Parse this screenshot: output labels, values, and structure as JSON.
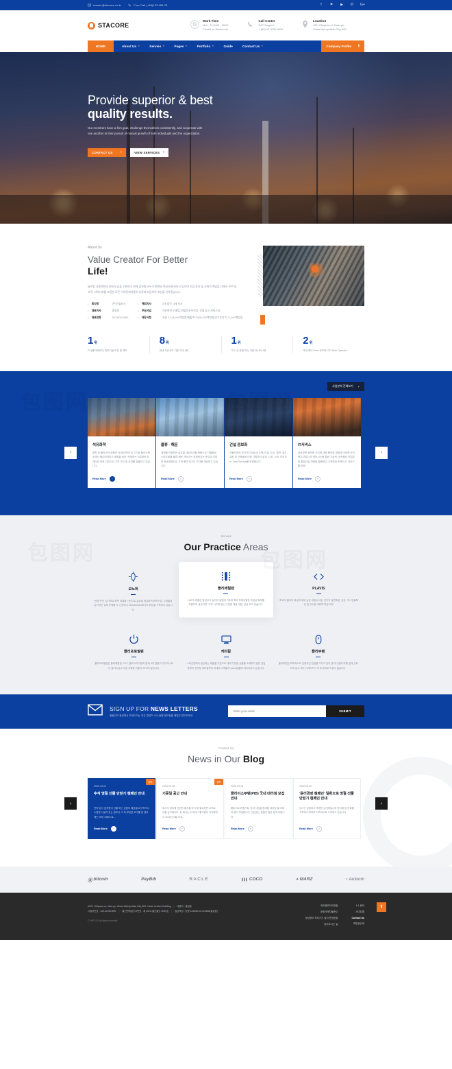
{
  "topbar": {
    "email": "master@stacore.co.kr",
    "phone": "Free Call (+86)123.456.78",
    "email_icon": "envelope-icon",
    "phone_icon": "phone-icon",
    "socials": [
      "f",
      "⚑",
      "▶",
      "ⓟ",
      "G+"
    ]
  },
  "header": {
    "logo_text": "STACORE",
    "info": [
      {
        "icon": "clock-icon",
        "title": "Work Time",
        "line1": "Mon - Fri 9:00 - 18:00",
        "line2": "Closed on Weekends"
      },
      {
        "icon": "phone-icon",
        "title": "Call Center",
        "line1": "24/7 Support",
        "line2": "+ (82) 00-0000-0000"
      },
      {
        "icon": "location-pin-icon",
        "title": "Location",
        "line1": "129, Okhyeon-ro, Nam-gu,",
        "line2": "Ulsan Metropolitan City, 802"
      }
    ]
  },
  "nav": {
    "home": "HOME",
    "items": [
      {
        "label": "About Us",
        "caret": "▼"
      },
      {
        "label": "Servies",
        "caret": "▼"
      },
      {
        "label": "Pages",
        "caret": "▼"
      },
      {
        "label": "Portfolio",
        "caret": "▼"
      },
      {
        "label": "Guide",
        "caret": ""
      },
      {
        "label": "Contact Us",
        "caret": "▼"
      }
    ],
    "cta": "Company Profile",
    "cta_icon": "download-icon"
  },
  "hero": {
    "line1": "Provide superior  & best",
    "line2": "quality  results.",
    "paragraph": "Our members have a firm goal, challenge themselves consistently, and cooperate with one another in their pursuit of mutual growth of both individuals and the organization.",
    "btn_primary": "CONTACT US",
    "btn_secondary": "VIEW SERVICES",
    "arrow": "›"
  },
  "about": {
    "eyebrow": "About Us",
    "title_light": "Value Creator For Better",
    "title_bold": "Life!",
    "paragraph": "글로벌 다품목화의 미래 모습을 구현하기 위해 임직원 모두가 변화와 혁신에 헌신하고 있으며 기업 윤리 및 사회적 책임을 다해서 주주 및 고객, 지역사회를 포함한 모든 이해관계자들의 성장에 보답하려 최선을 다하겠습니다.",
    "facts_col1": [
      {
        "key": "회사명",
        "value": "(주)산돌라스"
      },
      {
        "key": "대표이사",
        "value": "홍길동"
      },
      {
        "key": "대표전화",
        "value": "00-0000-0000"
      }
    ],
    "facts_col2": [
      {
        "key": "해외지사",
        "value": "2개 법인, 4개 지사"
      },
      {
        "key": "주요사업",
        "value": "석유화학 도매업, 화물운송주선업, 건설 및 IT서비스업"
      },
      {
        "key": "재무사항",
        "value": "자산 2,416,434백만원/매출액 2,628,219백만원/당기순이익 71,460백만원"
      }
    ],
    "image_alt": "worker-on-structure-photo"
  },
  "stats": [
    {
      "num": "1",
      "unit": "위",
      "desc": "PC(폴리머비드) 특허기술 보유 및 제조"
    },
    {
      "num": "8",
      "unit": "위",
      "desc": "연내 자산규모 기준 국내 8위"
    },
    {
      "num": "1",
      "unit": "위",
      "desc": "가스 선 운항 척수 기준 아시아 1위"
    },
    {
      "num": "2",
      "unit": "위",
      "desc": "국내 최대 Fleet 규모의 ISO Tank Operator"
    }
  ],
  "carousel": {
    "button": "사업분야 전체보기",
    "button_icon": "plus-icon",
    "prev_icon": "chevron-left-icon",
    "next_icon": "chevron-right-icon",
    "read_more": "Read More",
    "cards": [
      {
        "title": "석유화학",
        "body": "화학 및 플라스틱 제품의 국내외 판매 및 고기능 플라스틱 소재인 폴리아마이드 제품을 생산, 판매하는 석유화학 트레이딩 전문 기업으로 고객 가치 및 성과를 창출하고 있습니다."
      },
      {
        "title": "물류 · 해운",
        "body": "세계를 연결하는 글로벌 네트워크를 바탕으로 차별화된 스피드화물 물류·해운 서비스는 경쟁력있는 운임과 다양한 운송경쟁으로 고객 배려 최고의 가치를 제공하고 있습니다."
      },
      {
        "title": "건설 정보화",
        "body": "건물자재의 부가가치 상승과 주택, 타일, 도로, 항만, 철도, 교량 및 건축물에 대한 기획부터 설계, 시공, 시/도 이어지는 Total Service를 제공합니다."
      },
      {
        "title": "IT서비스",
        "body": "공공부문 정보화 사업에 대한 풍부한 경험과 다양한 아키텍처 파트너의 정보시스템 통합 기술력, 표준화된 방법론 및 통합사업 역량을 활용하여 고객에게 최적의 IT 서비스를 제공"
      }
    ]
  },
  "practice": {
    "eyebrow": "Servies",
    "title_bold": "Our Practice",
    "title_light": "Areas",
    "row1": [
      {
        "icon": "monomer-icon",
        "title": "모노머",
        "desc": "현재 산액, 싱가포르 화학 계열을 기반으로 글로벌 정유화학 화학기업, 고객들과 유기적인 업체 문제를 도·신장에서 Globaltrader로서의 위상을 구축하고 있습니다."
      },
      {
        "icon": "polyethylene-icon",
        "title": "폴리에틸렌",
        "desc": "HDPE 제품은 탈입크기 슬러리 공법에 기초한 특허 자체개발한 독점성 촉매를 적용하여 생산되며, 고객 니즈에 맞는 다양한 제품 개발, 공급 되고 있습니다.",
        "active": true
      },
      {
        "icon": "code-brackets-icon",
        "title": "PLAVIS",
        "desc": "최고의 물리적 특성과 매우 높은 내열시스템, 전기적 절연특성, 낮은 가스 방출특성 및 우수한 내화학 특성 보유"
      }
    ],
    "row2": [
      {
        "icon": "power-icon",
        "title": "폴리프로필렌",
        "desc": "폴리프로필렌은 폴리에틸렌, PVC, 폴리스타이렌과 함께 4대 범용수지이 하나로서, 열가소성수지 중 사용량 비중이 24%에 달한니다."
      },
      {
        "icon": "monitor-icon",
        "title": "케미칼",
        "desc": "스타산업에서 생산되는 제품을 기반으로 내외 다양한 상품을 소재까지 일반 공업용부터 전자용 케미칼까지 국내외 고객들의 value창출에 이바지하고 있습니다."
      },
      {
        "icon": "mouse-icon",
        "title": "폴리부텐",
        "desc": "폴리부텐은 화학적으로 안정적인 성질을 가지고 있어 빛이나 열에 의해 쉽게 산화되지 않고 모든 그레이드가 무색/무취로 독성이 없습니다."
      }
    ]
  },
  "newsletter": {
    "icon": "envelope-icon",
    "title_light": "SIGN UP FOR ",
    "title_bold": "NEWS LETTERS",
    "subtitle": "홍봉간이 정성에서 보내드리는 최신 콘텐츠 소식,동향,정보등을 메일로 받아보세요.",
    "placeholder": "Enter your email",
    "submit": "SUBMIT"
  },
  "blog": {
    "eyebrow": "Contact Us",
    "title_light": "News in Our ",
    "title_bold": "Blog",
    "read_more": "Read More",
    "prev_icon": "chevron-left-icon",
    "next_icon": "chevron-right-icon",
    "posts": [
      {
        "date": "2020.10.02",
        "badge": "공지",
        "title": "추석 명절 선물 안받기 캠페인 안내",
        "body": "만약 당사 임직원이 선물 또는 금품의 제공을 요구하거나 수령한 사실이 있는 경우나 그 외 부당한 요구를 한 경우에는 아래 <제보>로...",
        "highlight": true
      },
      {
        "date": "2020.09.28",
        "badge": "공지",
        "title": "기준일 공고 안내",
        "body": "회사의 업무에 관련한 통지를 하기 위 필요하면 으므로 아룀 공고합니다. 본 회사는 2018년 2월 6일자 이사회에서 2018년 2월 22일..."
      },
      {
        "date": "2020.09.15",
        "badge": "",
        "title": "폴리이소부텐(PIB) 국내 대리점 모집 안내",
        "body": "폴리이소부텐(PIB) 국내 사업을 함께할 대리점 을 아래와 같이 모집합니다. 관심있는 분들의 많은 참여 바랍니다."
      },
      {
        "date": "2020.08.30",
        "badge": "",
        "title": "'윤리경영 캠페인' 일환으로 명절 선물 안받기 캠페인 안내",
        "body": "당사는 공정하고 투명한 상거래질서와 윤리경 영 문화를 구축하고 위하여 지속적으로 노력하고 있습니다"
      }
    ]
  },
  "partners": [
    {
      "name": "bitcoin",
      "icon": "bitcoin-icon",
      "style": "italic"
    },
    {
      "name": "PayBib",
      "icon": "",
      "style": "bold-italic"
    },
    {
      "name": "RACLE",
      "icon": "",
      "style": "thin"
    },
    {
      "name": "COCO",
      "icon": "bars-icon",
      "style": "bold"
    },
    {
      "name": "MARZ",
      "icon": "diamond-icon",
      "style": "bold-italic"
    },
    {
      "name": "Autoom",
      "icon": "wave-icon",
      "style": "regular"
    }
  ],
  "footer": {
    "line1_a": "#129, Okhyeon-ro, Nam-gu, Ulsan Metropolitan City, 802, Ulsan Venture Building",
    "line1_b": "대표자 : 홍길동",
    "line2_a": "사업자번호 : 123-45-567890",
    "line2_b": "통신판매업신고번호 : 제 2020-울산울산-0000호",
    "line2_c": "집금책임 : 농협 123456-00-123456(홍길동)",
    "copyright": "© IMPCOS all rights reserved.",
    "links_col1": [
      "개인정보처리방침",
      "공정거래자율준수",
      "영상정보 처리기기 설치 운영방침",
      "찾아오시는 길"
    ],
    "links_col2": [
      "1:1 문의",
      "사이트맵",
      "Contact Us",
      "희망공인내"
    ],
    "top_icon": "arrow-up-icon"
  }
}
